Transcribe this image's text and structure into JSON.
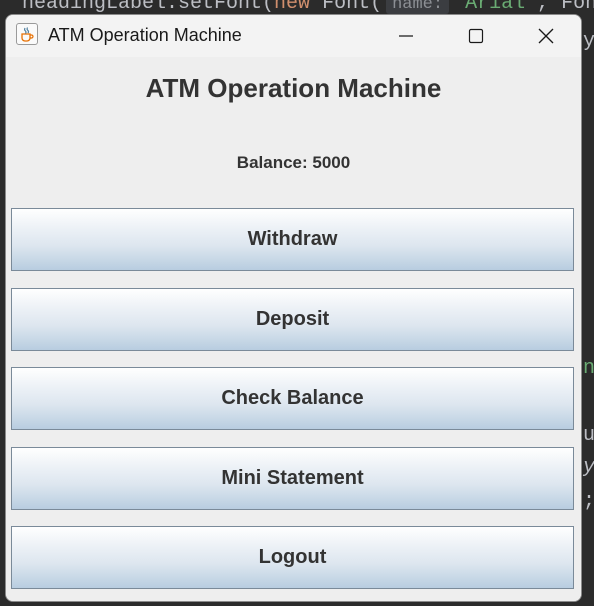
{
  "background_code": {
    "top_line_prefix": "headingLabel.setFont(",
    "top_line_keyword": "new",
    "top_line_class": " Font(",
    "top_line_hint": "name:",
    "top_line_string": "\"Arial\"",
    "top_line_suffix": ", Fon",
    "right_fragments": [
      "y",
      "ns",
      "ut",
      "yB",
      ";"
    ]
  },
  "window": {
    "title": "ATM Operation Machine",
    "icon": "java-cup-icon"
  },
  "main": {
    "heading": "ATM Operation Machine",
    "balance_text": "Balance: 5000"
  },
  "buttons": {
    "withdraw": "Withdraw",
    "deposit": "Deposit",
    "check_balance": "Check Balance",
    "mini_statement": "Mini Statement",
    "logout": "Logout"
  },
  "colors": {
    "button_gradient_top": "#ffffff",
    "button_gradient_bottom": "#b8cde0",
    "window_bg": "#eeeeee",
    "text": "#333333"
  }
}
